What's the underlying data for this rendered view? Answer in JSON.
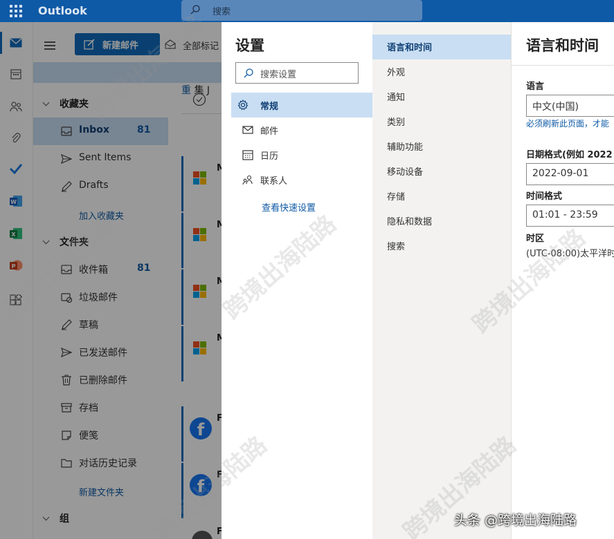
{
  "app": {
    "title": "Outlook"
  },
  "topbar": {
    "search_placeholder": "搜索"
  },
  "command_bar": {
    "new_mail": "新建邮件",
    "mark_all_read": "全部标记"
  },
  "folders": {
    "favorites_header": "收藏夹",
    "favorites": [
      {
        "label": "Inbox",
        "count": "81"
      },
      {
        "label": "Sent Items",
        "count": ""
      },
      {
        "label": "Drafts",
        "count": ""
      }
    ],
    "add_favorite": "加入收藏夹",
    "folders_header": "文件夹",
    "items": [
      {
        "label": "收件箱",
        "count": "81"
      },
      {
        "label": "垃圾邮件",
        "count": ""
      },
      {
        "label": "草稿",
        "count": ""
      },
      {
        "label": "已发送邮件",
        "count": ""
      },
      {
        "label": "已删除邮件",
        "count": ""
      },
      {
        "label": "存档",
        "count": ""
      },
      {
        "label": "便笺",
        "count": ""
      },
      {
        "label": "对话历史记录",
        "count": ""
      }
    ],
    "new_folder": "新建文件夹",
    "groups_header": "组"
  },
  "message_list": {
    "header_letter": "重",
    "section_letters": [
      "集",
      "J"
    ],
    "row_letters": [
      "M",
      "M",
      "M",
      "M",
      "F",
      "F",
      "F"
    ]
  },
  "settings": {
    "title": "设置",
    "search_placeholder": "搜索设置",
    "categories": [
      {
        "label": "常规",
        "icon": "gear-icon"
      },
      {
        "label": "邮件",
        "icon": "mail-icon"
      },
      {
        "label": "日历",
        "icon": "calendar-icon"
      },
      {
        "label": "联系人",
        "icon": "people-icon"
      }
    ],
    "quick_settings_link": "查看快速设置",
    "subcategories": [
      "语言和时间",
      "外观",
      "通知",
      "类别",
      "辅助功能",
      "移动设备",
      "存储",
      "隐私和数据",
      "搜索"
    ],
    "pane": {
      "title": "语言和时间",
      "language_label": "语言",
      "language_value": "中文(中国)",
      "refresh_note": "必须刷新此页面，才能",
      "date_format_label": "日期格式(例如 2022",
      "date_format_value": "2022-09-01",
      "time_format_label": "时间格式",
      "time_format_value": "01:01 - 23:59",
      "timezone_label": "时区",
      "timezone_value": "(UTC-08:00)太平洋时"
    }
  },
  "credit": "头条 @跨境出海陆路",
  "watermark": "跨境出海陆路",
  "colors": {
    "brand": "#0f5aa6",
    "accent": "#0f6cbd",
    "selection": "#c9def3"
  }
}
